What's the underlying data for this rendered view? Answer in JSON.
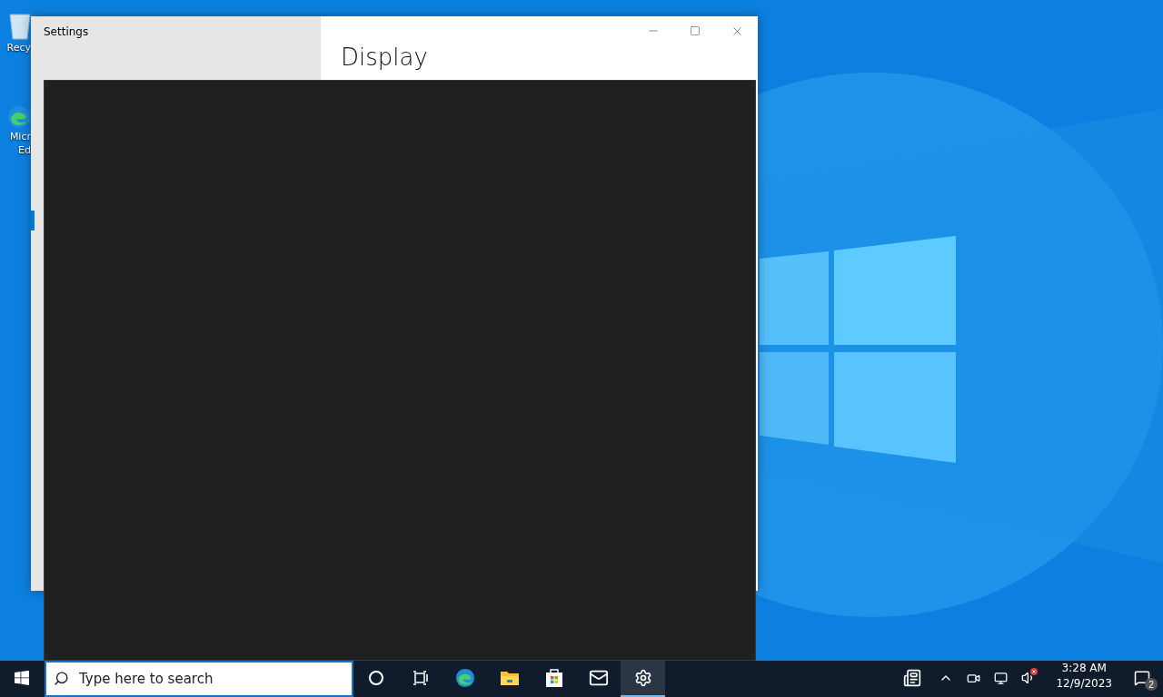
{
  "desktop": {
    "icons": [
      {
        "kind": "recycle-bin",
        "label_lines": [
          "Recy"
        ]
      },
      {
        "kind": "edge",
        "label_lines": [
          "Micr",
          "Ed"
        ]
      }
    ]
  },
  "settings_window": {
    "title": "Settings",
    "heading": "Display",
    "nav_selected": true
  },
  "taskbar": {
    "search": {
      "placeholder": "Type here to search"
    },
    "apps": [
      {
        "kind": "cortana",
        "active": false
      },
      {
        "kind": "task-view",
        "active": false
      },
      {
        "kind": "edge",
        "active": false
      },
      {
        "kind": "explorer",
        "active": false
      },
      {
        "kind": "store",
        "active": false
      },
      {
        "kind": "mail",
        "active": false
      },
      {
        "kind": "settings",
        "active": true
      }
    ],
    "tray": {
      "volume_muted": true
    },
    "clock": {
      "time": "3:28 AM",
      "date": "12/9/2023"
    },
    "notifications": {
      "count": "2"
    }
  }
}
